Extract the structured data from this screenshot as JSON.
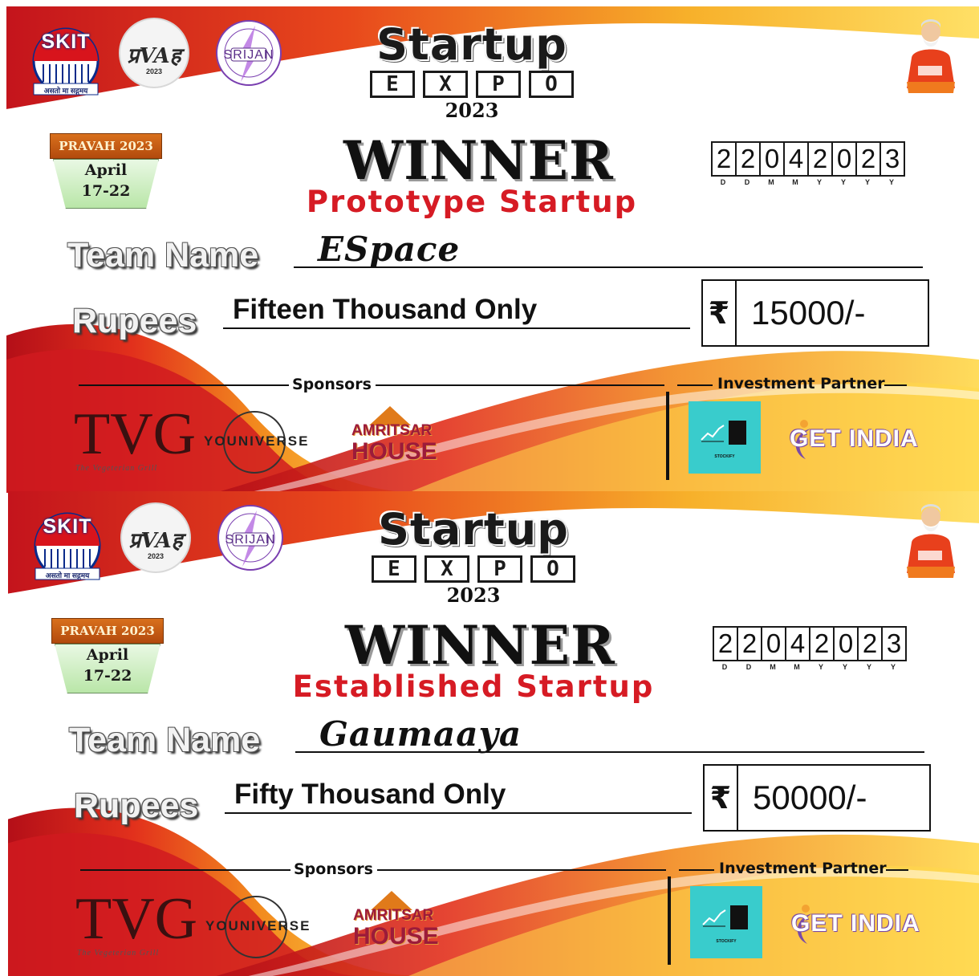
{
  "cheques": [
    {
      "institute": {
        "name": "SKIT",
        "motto": "असतो मा सद्गमय"
      },
      "pravah_logo": {
        "text": "प्रVAह",
        "year": "2023"
      },
      "srijan_logo": {
        "text": "SRIJAN"
      },
      "event_title": {
        "line1": "Startup",
        "line2": [
          "E",
          "X",
          "P",
          "O"
        ],
        "year": "2023"
      },
      "badge": {
        "title": "PRAVAH 2023",
        "month": "April",
        "days": "17-22"
      },
      "heading": "WINNER",
      "category": "Prototype Startup",
      "date_digits": [
        "2",
        "2",
        "0",
        "4",
        "2",
        "0",
        "2",
        "3"
      ],
      "date_format": [
        "D",
        "D",
        "M",
        "M",
        "Y",
        "Y",
        "Y",
        "Y"
      ],
      "team_name_label": "Team Name",
      "team_name": "ESpace",
      "rupees_label": "Rupees",
      "amount_words": "Fifteen Thousand Only",
      "rupee_symbol": "₹",
      "amount": "15000/-",
      "sponsors_label": "Sponsors",
      "investment_label": "Investment Partner",
      "sponsors": {
        "tvg": "TVG",
        "tvg_sub": "The Vegeterian Grill",
        "universe": "YOUNIVERSE",
        "amritsar_1": "AMRITSAR",
        "amritsar_2": "HOUSE"
      },
      "partners": {
        "stockify": "STOCKIFY",
        "getindia": "GET INDIA"
      }
    },
    {
      "institute": {
        "name": "SKIT",
        "motto": "असतो मा सद्गमय"
      },
      "pravah_logo": {
        "text": "प्रVAह",
        "year": "2023"
      },
      "srijan_logo": {
        "text": "SRIJAN"
      },
      "event_title": {
        "line1": "Startup",
        "line2": [
          "E",
          "X",
          "P",
          "O"
        ],
        "year": "2023"
      },
      "badge": {
        "title": "PRAVAH 2023",
        "month": "April",
        "days": "17-22"
      },
      "heading": "WINNER",
      "category": "Established Startup",
      "date_digits": [
        "2",
        "2",
        "0",
        "4",
        "2",
        "0",
        "2",
        "3"
      ],
      "date_format": [
        "D",
        "D",
        "M",
        "M",
        "Y",
        "Y",
        "Y",
        "Y"
      ],
      "team_name_label": "Team Name",
      "team_name": "Gaumaaya",
      "rupees_label": "Rupees",
      "amount_words": "Fifty Thousand Only",
      "rupee_symbol": "₹",
      "amount": "50000/-",
      "sponsors_label": "Sponsors",
      "investment_label": "Investment Partner",
      "sponsors": {
        "tvg": "TVG",
        "tvg_sub": "The Vegeterian Grill",
        "universe": "YOUNIVERSE",
        "amritsar_1": "AMRITSAR",
        "amritsar_2": "HOUSE"
      },
      "partners": {
        "stockify": "STOCKIFY",
        "getindia": "GET INDIA"
      }
    }
  ],
  "colors": {
    "accent_red": "#d61b24",
    "wave_orange": "#f39a1e",
    "wave_yellow": "#ffd84a",
    "stockify_teal": "#39cccc"
  }
}
